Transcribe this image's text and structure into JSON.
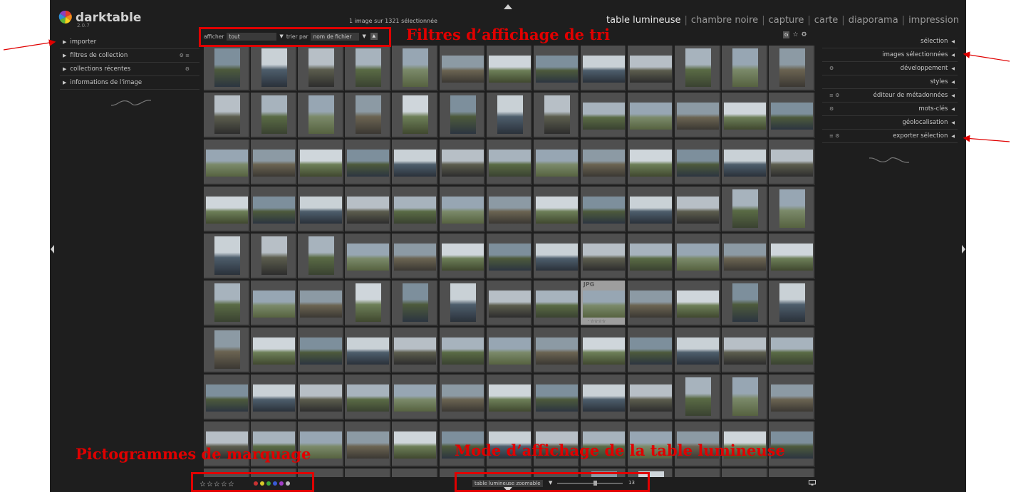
{
  "header": {
    "app_name": "darktable",
    "version": "2.0.7",
    "selection_count": "1 image sur 1321 sélectionnée",
    "views": [
      "table lumineuse",
      "chambre noire",
      "capture",
      "carte",
      "diaporama",
      "impression"
    ],
    "active_view": "table lumineuse"
  },
  "left_panel": {
    "items": [
      {
        "label": "importer",
        "icons": ""
      },
      {
        "label": "filtres de collection",
        "icons": "⚙ ≡"
      },
      {
        "label": "collections récentes",
        "icons": "⚙"
      },
      {
        "label": "informations de l'image",
        "icons": ""
      }
    ]
  },
  "filter_bar": {
    "show_label": "afficher",
    "show_value": "tout",
    "sort_label": "trier par",
    "sort_value": "nom de fichier",
    "sort_dir_icon": "▲"
  },
  "top_right_icons": {
    "grouping_label": "G",
    "star_icon": "☆",
    "gear_icon": "⚙"
  },
  "right_panel": {
    "items": [
      {
        "label": "sélection",
        "icons": ""
      },
      {
        "label": "images sélectionnées",
        "icons": ""
      },
      {
        "label": "développement",
        "icons": "⚙"
      },
      {
        "label": "styles",
        "icons": ""
      },
      {
        "label": "éditeur de métadonnées",
        "icons": "≡ ⚙"
      },
      {
        "label": "mots-clés",
        "icons": "⚙"
      },
      {
        "label": "géolocalisation",
        "icons": ""
      },
      {
        "label": "exporter sélection",
        "icons": "≡ ⚙"
      }
    ]
  },
  "thumbnail_grid": {
    "columns": 13,
    "visible_rows": 10,
    "hovered_thumb_label": "JPG",
    "hovered_thumb_stars": "· ☆☆☆☆"
  },
  "bottom_bar": {
    "stars": "☆☆☆☆☆",
    "color_labels": [
      "#c83232",
      "#d6c82a",
      "#3caa3c",
      "#3a5ad6",
      "#a03cc8",
      "#bbbbbb"
    ],
    "layout_mode": "table lumineuse zoomable",
    "zoom_columns": "13"
  },
  "annotations": {
    "filters": "Filtres d’affichage de tri",
    "pictograms": "Pictogrammes de marquage",
    "lighttable_mode": "Mode d’affichage de la table lumineuse"
  }
}
